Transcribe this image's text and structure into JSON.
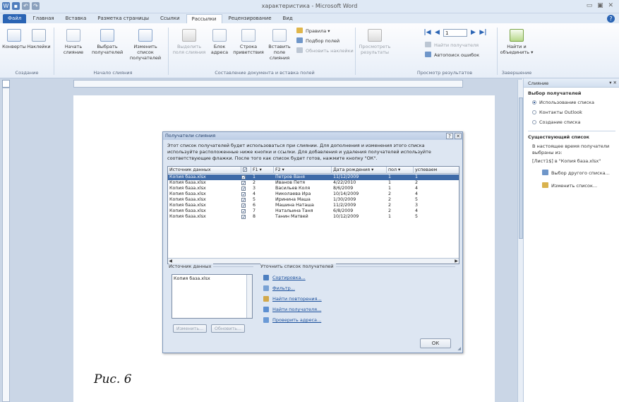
{
  "window": {
    "title": "характеристика - Microsoft Word"
  },
  "tabs": [
    "Файл",
    "Главная",
    "Вставка",
    "Разметка страницы",
    "Ссылки",
    "Рассылки",
    "Рецензирование",
    "Вид"
  ],
  "ribbon": {
    "groups": {
      "create": "Создание",
      "start_merge": "Начало слияния",
      "write_insert": "Составление документа и вставка полей",
      "preview": "Просмотр результатов",
      "finish": "Завершение"
    },
    "buttons": {
      "envelopes": "Конверты",
      "labels": "Наклейки",
      "start_merge": "Начать слияние",
      "select_recipients": "Выбрать получателей",
      "edit_list": "Изменить список получателей",
      "highlight_fields": "Выделить поля слияния",
      "address_block": "Блок адреса",
      "greeting_line": "Строка приветствия",
      "insert_field": "Вставить поле слияния",
      "rules": "Правила",
      "match_fields": "Подбор полей",
      "update_labels": "Обновить наклейки",
      "preview_results": "Просмотреть результаты",
      "find_recipient": "Найти получателя",
      "auto_check": "Автопоиск ошибок",
      "finish_merge": "Найти и объединить"
    },
    "record_number": "1"
  },
  "pane": {
    "title": "Слияние",
    "select_heading": "Выбор получателей",
    "opt_use_list": "Использование списка",
    "opt_outlook": "Контакты Outlook",
    "opt_new_list": "Создание списка",
    "existing_heading": "Существующий список",
    "existing_text1": "В настоящее время получатели",
    "existing_text2": "выбраны из:",
    "existing_source": "[Лист1$] в \"Копия база.xlsx\"",
    "link_other": "Выбор другого списка...",
    "link_edit": "Изменить список..."
  },
  "dialog": {
    "title": "Получатели слияния",
    "help": "?",
    "close": "✕",
    "text1": "Этот список получателей будет использоваться при слиянии. Для дополнения и изменения этого списка",
    "text2": "используйте расположенные ниже кнопки и ссылки. Для добавления и удаления получателей используйте",
    "text3": "соответствующие флажки. После того как список будет готов, нажмите кнопку \"ОК\".",
    "columns": [
      "Источник данных",
      "",
      "F1",
      "F2",
      "Дата рождения",
      "пол",
      "успеваем"
    ],
    "rows": [
      {
        "src": "Копия база.xlsx",
        "f1": "1",
        "f2": "Петров Ваня",
        "date": "11/12/2009",
        "sex": "1",
        "grade": "1"
      },
      {
        "src": "Копия база.xlsx",
        "f1": "2",
        "f2": "Иванов Петя",
        "date": "4/22/2010",
        "sex": "1",
        "grade": "2"
      },
      {
        "src": "Копия база.xlsx",
        "f1": "3",
        "f2": "Васильев Коля",
        "date": "8/6/2009",
        "sex": "1",
        "grade": "4"
      },
      {
        "src": "Копия база.xlsx",
        "f1": "4",
        "f2": "Николаева Ира",
        "date": "10/14/2009",
        "sex": "2",
        "grade": "4"
      },
      {
        "src": "Копия база.xlsx",
        "f1": "5",
        "f2": "Иринина Маша",
        "date": "1/30/2009",
        "sex": "2",
        "grade": "5"
      },
      {
        "src": "Копия база.xlsx",
        "f1": "6",
        "f2": "Машина Наташа",
        "date": "11/2/2009",
        "sex": "2",
        "grade": "3"
      },
      {
        "src": "Копия база.xlsx",
        "f1": "7",
        "f2": "Натальина Таня",
        "date": "6/8/2009",
        "sex": "2",
        "grade": "4"
      },
      {
        "src": "Копия база.xlsx",
        "f1": "8",
        "f2": "Танин Матвей",
        "date": "10/12/2009",
        "sex": "1",
        "grade": "5"
      }
    ],
    "src_label": "Источник данных",
    "src_item": "Копия база.xlsx",
    "btn_edit": "Изменить...",
    "btn_refresh": "Обновить...",
    "refine_label": "Уточнить список получателей",
    "links": [
      "Сортировка...",
      "Фильтр...",
      "Найти повторения...",
      "Найти получателя...",
      "Проверить адреса..."
    ],
    "ok": "ОК"
  },
  "caption": "Рис. 6"
}
